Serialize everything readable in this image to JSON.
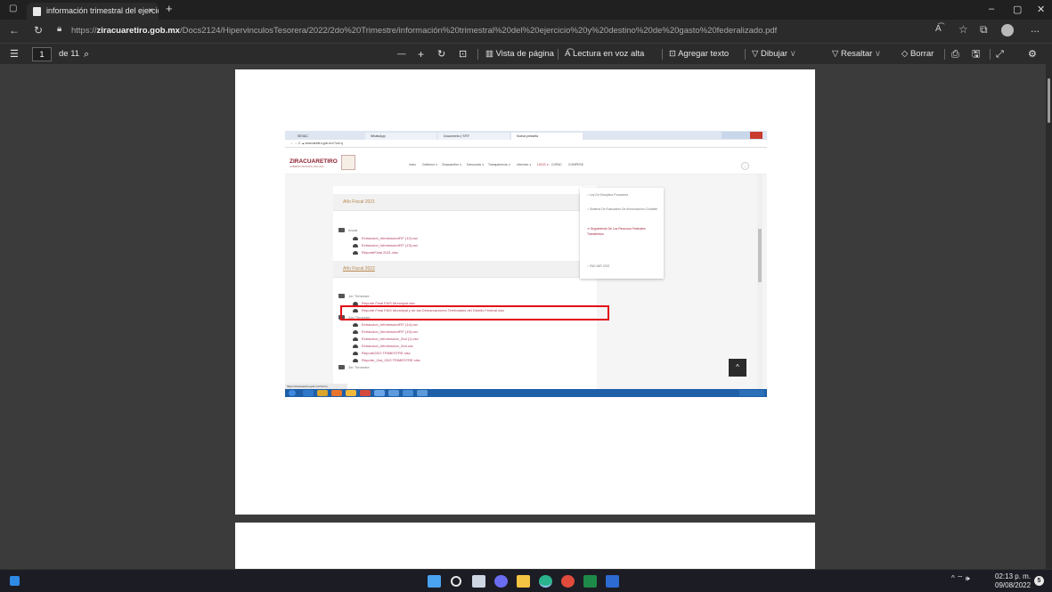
{
  "browser": {
    "tab_title": "información trimestral del ejercici",
    "tab_close": "×",
    "new_tab": "+",
    "window_controls": [
      "–",
      "▢",
      "✕"
    ],
    "url_prefix": "https://",
    "url_host": "ziracuaretiro.gob.mx",
    "url_path": "/Docs2124/HipervinculosTesorera/2022/2do%20Trimestre/información%20trimestral%20del%20ejercicio%20y%20destino%20de%20gasto%20federalizado.pdf",
    "more_label": "..."
  },
  "pdf_toolbar": {
    "page_number": "1",
    "page_total": "de 11",
    "zoom_out": "—",
    "zoom_in": "+",
    "page_view": "Vista de página",
    "read_aloud": "Lectura en voz alta",
    "add_text": "Agregar texto",
    "draw": "Dibujar",
    "highlight": "Resaltar",
    "erase": "Borrar"
  },
  "embedded": {
    "tabs": [
      "SEVAC",
      "WhatsApp",
      "Documento | SFIT",
      "Nueva pestaña"
    ],
    "address": "ziracuaretiro.gob.mx/?url=q",
    "logo_text": "ZIRACUARETIRO",
    "logo_sub": "GOBIERNO MUNICIPAL 2021-2024",
    "nav_items": [
      "Inicio",
      "Gobierno ∨",
      "Ziracuaretiro ∨",
      "Denuncias ∨",
      "Transparencia ∨",
      "Informes ∨",
      "LGCG ∨",
      "COPAC",
      "COMPESE"
    ],
    "year_2021": "Año Fiscal 2021",
    "folder_anual": "Anual",
    "files_2021": [
      "Extraccion_InformacionFIF (12).csv",
      "Extraccion_InformacionFIF (13).csv",
      "ReporteFinal 2021.xlsx"
    ],
    "year_2022": "Año Fiscal 2022",
    "folder_1er": "1er Trimestre",
    "files_1er": [
      "Reporte Final FAIS Municipal.xlsx",
      "Reporte Final FAIS Municipal y de las Demarcaciones Territoriales del Distrito Federal.xlsx"
    ],
    "folder_2do": "2do Trimestre",
    "files_2do": [
      "Extraccion_InformacionFIF (14).csv",
      "Extraccion_InformacionFIF (15).csv",
      "Extraccion_Informacion_2nd (1).csv",
      "Extraccion_Informacion_2nd.csv",
      "Reporte2DO TRIMESTRE.xlsx",
      "Reporte_2nd_2DO TRIMESTRE.xlsx"
    ],
    "folder_3er": "3er Trimestre",
    "dropdown_items": [
      "Ley De Disciplina Financiera",
      "Sistema De Evaluación De Armonización Contable",
      "Seguimiento De Los Recursos Federales Transferidos",
      "PAE-MIR 2022"
    ],
    "status_url": "https://ziracuaretiro.gob.mx/?url=q",
    "to_top": "^"
  },
  "taskbar": {
    "time": "02:13 p. m.",
    "date": "09/08/2022",
    "notifications": "5",
    "tray_icons": "^ ⌔ 🕪"
  }
}
